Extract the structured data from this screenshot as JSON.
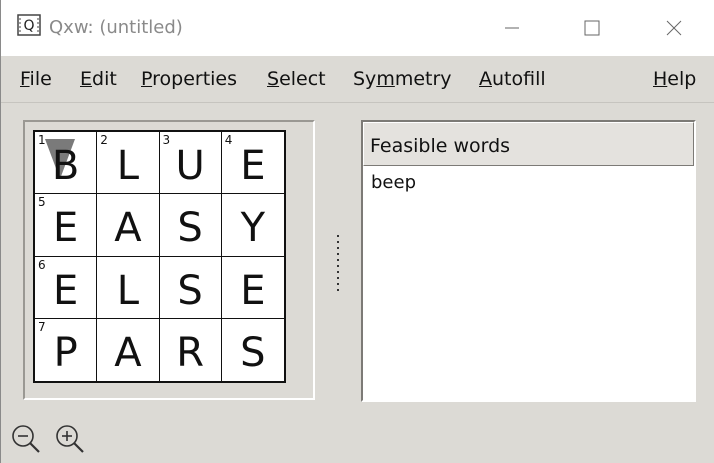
{
  "window": {
    "title": "Qxw: (untitled)",
    "app_icon_letter": "Q"
  },
  "menu": {
    "items": [
      {
        "pre": "",
        "ul": "F",
        "post": "ile"
      },
      {
        "pre": "",
        "ul": "E",
        "post": "dit"
      },
      {
        "pre": "",
        "ul": "P",
        "post": "roperties"
      },
      {
        "pre": "",
        "ul": "S",
        "post": "elect"
      },
      {
        "pre": "Sy",
        "ul": "m",
        "post": "metry"
      },
      {
        "pre": "",
        "ul": "A",
        "post": "utofill"
      },
      {
        "pre": "",
        "ul": "H",
        "post": "elp"
      }
    ]
  },
  "grid": {
    "cells": [
      [
        {
          "num": "1",
          "letter": "B"
        },
        {
          "num": "2",
          "letter": "L"
        },
        {
          "num": "3",
          "letter": "U"
        },
        {
          "num": "4",
          "letter": "E"
        }
      ],
      [
        {
          "num": "5",
          "letter": "E"
        },
        {
          "num": "",
          "letter": "A"
        },
        {
          "num": "",
          "letter": "S"
        },
        {
          "num": "",
          "letter": "Y"
        }
      ],
      [
        {
          "num": "6",
          "letter": "E"
        },
        {
          "num": "",
          "letter": "L"
        },
        {
          "num": "",
          "letter": "S"
        },
        {
          "num": "",
          "letter": "E"
        }
      ],
      [
        {
          "num": "7",
          "letter": "P"
        },
        {
          "num": "",
          "letter": "A"
        },
        {
          "num": "",
          "letter": "R"
        },
        {
          "num": "",
          "letter": "S"
        }
      ]
    ]
  },
  "feasible": {
    "header": "Feasible words",
    "words": [
      "beep"
    ]
  },
  "icons": {
    "zoom_out": "zoom-out-icon",
    "zoom_in": "zoom-in-icon",
    "cursor": "cursor-down-triangle-icon"
  },
  "colors": {
    "window_bg": "#dcdad5",
    "titlebar_bg": "#ffffff",
    "cursor_mark": "#7a7a7a"
  }
}
